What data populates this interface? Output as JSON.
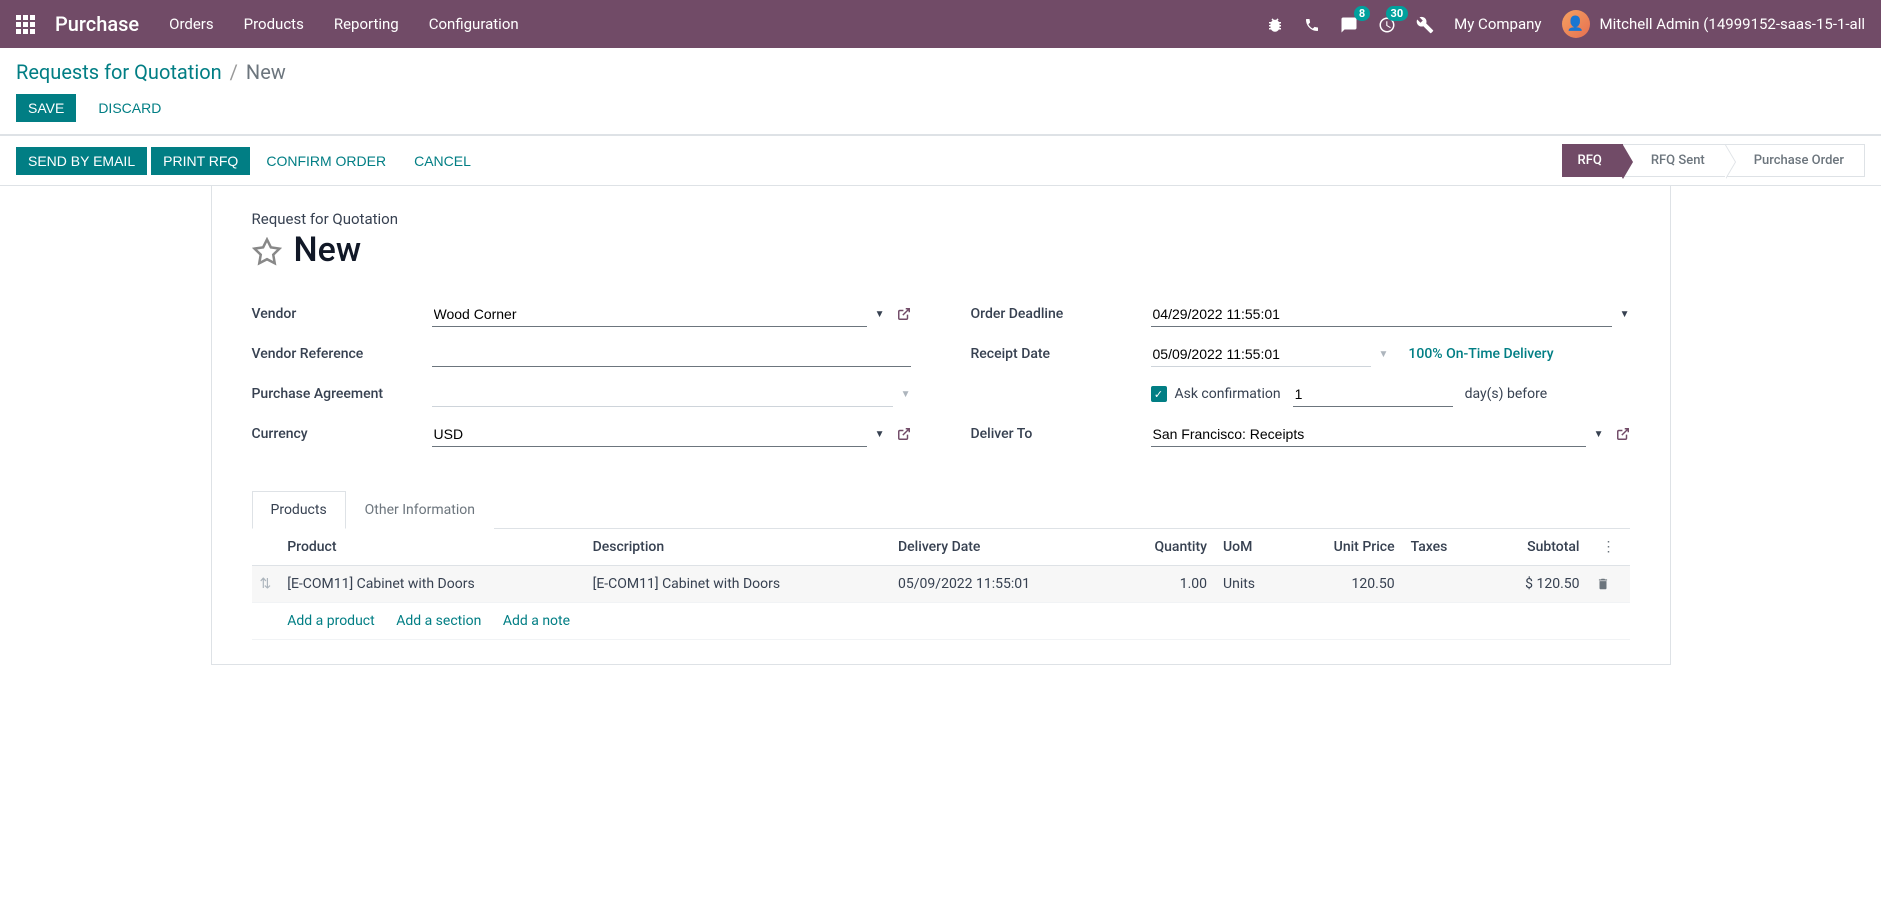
{
  "nav": {
    "brand": "Purchase",
    "menu": [
      "Orders",
      "Products",
      "Reporting",
      "Configuration"
    ],
    "messaging_badge": "8",
    "activity_badge": "30",
    "company": "My Company",
    "user": "Mitchell Admin (14999152-saas-15-1-all"
  },
  "breadcrumb": {
    "parent": "Requests for Quotation",
    "current": "New"
  },
  "cp_buttons": {
    "save": "Save",
    "discard": "Discard"
  },
  "statusbar": {
    "send_email": "Send by Email",
    "print_rfq": "Print RFQ",
    "confirm": "Confirm Order",
    "cancel": "Cancel",
    "steps": [
      "RFQ",
      "RFQ Sent",
      "Purchase Order"
    ]
  },
  "form": {
    "title_label": "Request for Quotation",
    "title": "New",
    "labels": {
      "vendor": "Vendor",
      "vendor_ref": "Vendor Reference",
      "purchase_agreement": "Purchase Agreement",
      "currency": "Currency",
      "order_deadline": "Order Deadline",
      "receipt_date": "Receipt Date",
      "deliver_to": "Deliver To"
    },
    "values": {
      "vendor": "Wood Corner",
      "vendor_ref": "",
      "purchase_agreement": "",
      "currency": "USD",
      "order_deadline": "04/29/2022 11:55:01",
      "receipt_date": "05/09/2022 11:55:01",
      "deliver_to": "San Francisco: Receipts"
    },
    "ontime_link": "100% On-Time Delivery",
    "ask_confirmation": {
      "label": "Ask confirmation",
      "days_value": "1",
      "suffix": "day(s) before"
    }
  },
  "tabs": {
    "products": "Products",
    "other": "Other Information"
  },
  "table": {
    "headers": {
      "product": "Product",
      "description": "Description",
      "delivery_date": "Delivery Date",
      "quantity": "Quantity",
      "uom": "UoM",
      "unit_price": "Unit Price",
      "taxes": "Taxes",
      "subtotal": "Subtotal"
    },
    "row": {
      "product": "[E-COM11] Cabinet with Doors",
      "description": "[E-COM11] Cabinet with Doors",
      "delivery_date": "05/09/2022 11:55:01",
      "quantity": "1.00",
      "uom": "Units",
      "unit_price": "120.50",
      "taxes": "",
      "subtotal": "$ 120.50"
    },
    "add_links": {
      "product": "Add a product",
      "section": "Add a section",
      "note": "Add a note"
    }
  }
}
